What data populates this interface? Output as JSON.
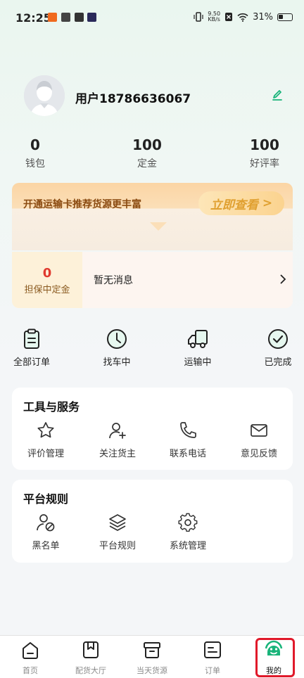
{
  "status_bar": {
    "time": "12:25",
    "net_speed_value": "9.50",
    "net_speed_unit": "KB/s",
    "battery": "31%"
  },
  "profile": {
    "username": "用户18786636067"
  },
  "stats": [
    {
      "value": "0",
      "label": "钱包"
    },
    {
      "value": "100",
      "label": "定金"
    },
    {
      "value": "100",
      "label": "好评率"
    }
  ],
  "promo": {
    "text": "开通运输卡推荐货源更丰富",
    "button": "立即查看",
    "button_arrow": ">"
  },
  "message": {
    "escrow_value": "0",
    "escrow_label": "担保中定金",
    "text": "暂无消息"
  },
  "orders": [
    {
      "label": "全部订单",
      "icon": "clipboard-icon"
    },
    {
      "label": "找车中",
      "icon": "clock-icon"
    },
    {
      "label": "运输中",
      "icon": "truck-icon"
    },
    {
      "label": "已完成",
      "icon": "check-circle-icon"
    }
  ],
  "tools": {
    "title": "工具与服务",
    "items": [
      {
        "label": "评价管理",
        "icon": "star-icon"
      },
      {
        "label": "关注货主",
        "icon": "user-add-icon"
      },
      {
        "label": "联系电话",
        "icon": "phone-icon"
      },
      {
        "label": "意见反馈",
        "icon": "mail-icon"
      }
    ]
  },
  "rules": {
    "title": "平台规则",
    "items": [
      {
        "label": "黑名单",
        "icon": "user-block-icon"
      },
      {
        "label": "平台规则",
        "icon": "layers-icon"
      },
      {
        "label": "系统管理",
        "icon": "gear-icon"
      }
    ]
  },
  "tabbar": [
    {
      "label": "首页",
      "icon": "home-icon"
    },
    {
      "label": "配货大厅",
      "icon": "bookmark-icon"
    },
    {
      "label": "当天货源",
      "icon": "archive-icon"
    },
    {
      "label": "订单",
      "icon": "order-list-icon"
    },
    {
      "label": "我的",
      "icon": "mascot-icon",
      "active": true
    }
  ],
  "colors": {
    "accent_green": "#19b47a",
    "highlight_red": "#e0192a",
    "escrow_red": "#e03a2f",
    "promo_brown": "#8a4a10"
  }
}
